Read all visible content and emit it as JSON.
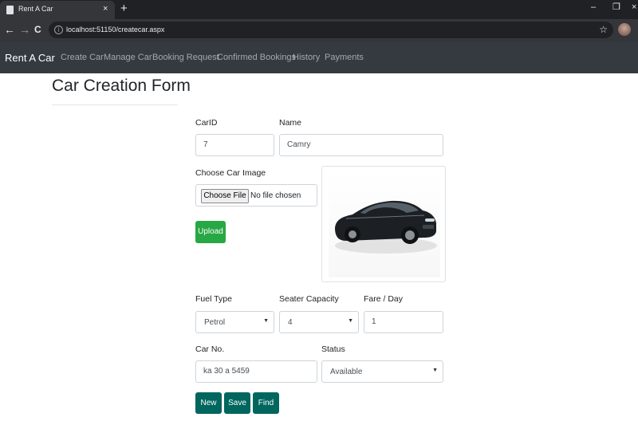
{
  "browser": {
    "tab_title": "Rent A Car",
    "tab_close": "×",
    "new_tab": "+",
    "minimize": "–",
    "restore": "❐",
    "close": "×",
    "back": "←",
    "forward": "→",
    "reload": "C",
    "info": "i",
    "url": "localhost:51150/createcar.aspx",
    "star": "☆"
  },
  "navbar": {
    "brand": "Rent A Car",
    "links": [
      "Create Car",
      "Manage Car",
      "Booking Request",
      "Confirmed Bookings",
      "History",
      "Payments"
    ]
  },
  "page": {
    "title": "Car Creation Form"
  },
  "form": {
    "car_id": {
      "label": "CarID",
      "value": "7"
    },
    "name": {
      "label": "Name",
      "value": "Camry"
    },
    "image": {
      "label": "Choose Car Image",
      "choose_button": "Choose File",
      "status": "No file chosen",
      "upload_button": "Upload"
    },
    "fuel_type": {
      "label": "Fuel Type",
      "value": "Petrol"
    },
    "seater_capacity": {
      "label": "Seater Capacity",
      "value": "4"
    },
    "fare": {
      "label": "Fare / Day",
      "value": "1"
    },
    "car_no": {
      "label": "Car No.",
      "value": "ka 30 a 5459"
    },
    "status": {
      "label": "Status",
      "value": "Available"
    },
    "select_arrow": "▼",
    "buttons": {
      "new": "New",
      "save": "Save",
      "find": "Find"
    }
  },
  "colors": {
    "navbar": "#343a40",
    "upload": "#28a745",
    "action": "#00665e",
    "car_body": "#1c2024"
  }
}
